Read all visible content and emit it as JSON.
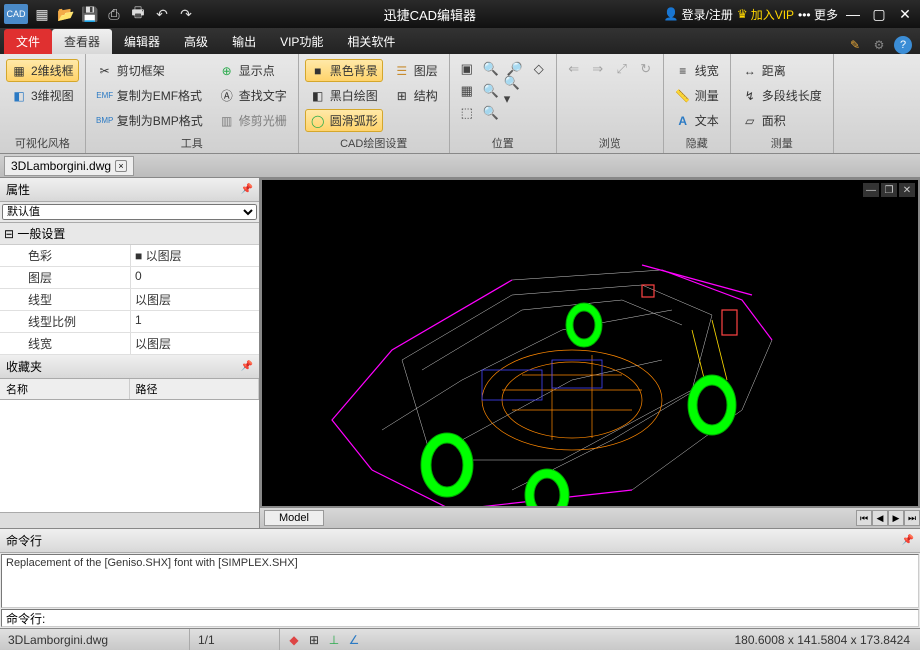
{
  "titlebar": {
    "app_badge": "CAD",
    "title": "迅捷CAD编辑器",
    "login": "登录/注册",
    "vip": "加入VIP",
    "more": "更多"
  },
  "menu": {
    "file": "文件",
    "tabs": [
      "查看器",
      "编辑器",
      "高级",
      "输出",
      "VIP功能",
      "相关软件"
    ]
  },
  "ribbon": {
    "g1": {
      "label": "可视化风格",
      "b1": "2维线框",
      "b2": "3维视图"
    },
    "g2": {
      "label": "工具",
      "b1": "剪切框架",
      "b2": "复制为EMF格式",
      "b3": "复制为BMP格式",
      "c1": "显示点",
      "c2": "查找文字",
      "c3": "修剪光栅"
    },
    "g3": {
      "label": "CAD绘图设置",
      "b1": "黑色背景",
      "b2": "黑白绘图",
      "b3": "圆滑弧形",
      "c1": "图层",
      "c2": "结构"
    },
    "g4": {
      "label": "位置"
    },
    "g5": {
      "label": "浏览"
    },
    "g6": {
      "b1": "线宽",
      "b2": "测量",
      "b3": "文本",
      "label": "隐藏"
    },
    "g7": {
      "b1": "距离",
      "b2": "多段线长度",
      "b3": "面积",
      "label": "测量"
    }
  },
  "doctab": {
    "name": "3DLamborgini.dwg"
  },
  "props": {
    "title": "属性",
    "default": "默认值",
    "section": "一般设置",
    "rows": [
      {
        "k": "色彩",
        "v": "■ 以图层"
      },
      {
        "k": "图层",
        "v": "0"
      },
      {
        "k": "线型",
        "v": "以图层"
      },
      {
        "k": "线型比例",
        "v": "1"
      },
      {
        "k": "线宽",
        "v": "以图层"
      }
    ]
  },
  "fav": {
    "title": "收藏夹",
    "col1": "名称",
    "col2": "路径"
  },
  "model_tab": "Model",
  "cmd": {
    "title": "命令行",
    "output": "Replacement of the [Geniso.SHX] font with [SIMPLEX.SHX]",
    "prompt": "命令行:"
  },
  "status": {
    "file": "3DLamborgini.dwg",
    "page": "1/1",
    "coords": "180.6008 x 141.5804 x 173.8424"
  }
}
